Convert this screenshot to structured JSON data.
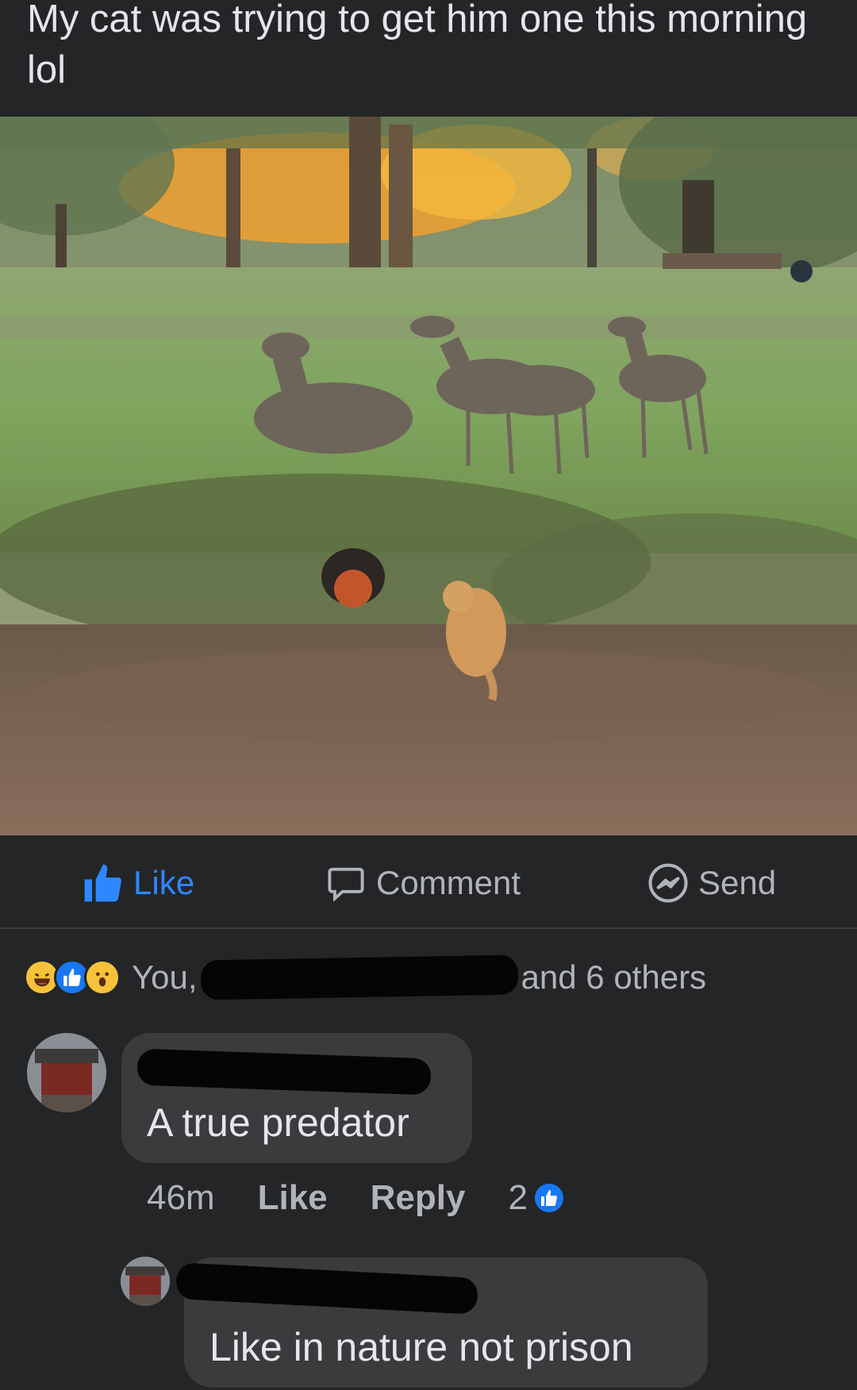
{
  "post": {
    "text": "My cat was trying to get him one this morning lol"
  },
  "actions": {
    "like": "Like",
    "comment": "Comment",
    "send": "Send"
  },
  "reactions": {
    "types": [
      "haha",
      "like",
      "wow"
    ],
    "names_prefix": "You,",
    "names_suffix": "and 6 others"
  },
  "comments": [
    {
      "text": "A true predator",
      "time": "46m",
      "like_label": "Like",
      "reply_label": "Reply",
      "reaction_count": "2"
    },
    {
      "text": "Like in nature not prison"
    }
  ],
  "colors": {
    "background": "#242526",
    "bubble": "#3a3b3c",
    "like_blue": "#2d88ff",
    "muted_text": "#b0b3b8",
    "primary_text": "#e4e6eb"
  }
}
